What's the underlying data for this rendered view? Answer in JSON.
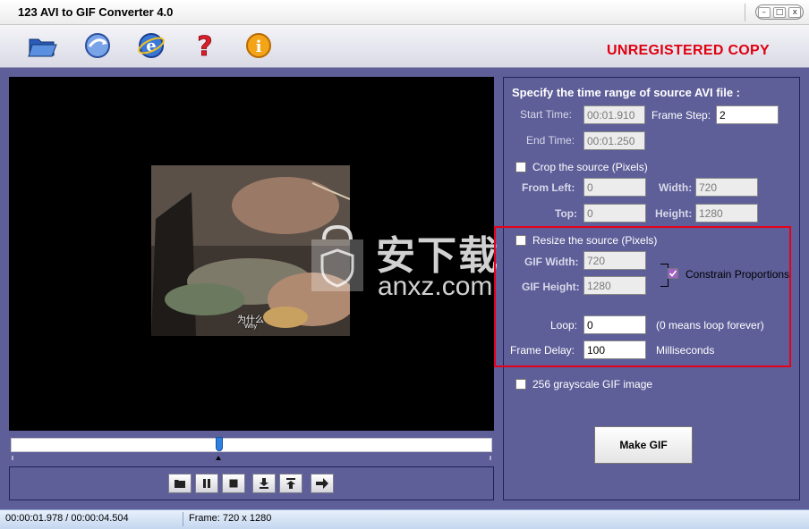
{
  "window": {
    "title": "123 AVI to GIF Converter 4.0"
  },
  "window_controls": {
    "minimize": "–",
    "maximize": "□",
    "close": "x"
  },
  "toolbar": {
    "unregistered": "UNREGISTERED COPY"
  },
  "video": {
    "subtitle_cn": "为什么",
    "subtitle_en": "Why"
  },
  "watermark": {
    "text": "安下载",
    "url": "anxz.com"
  },
  "playback": {
    "position": 0.43
  },
  "settings": {
    "heading": "Specify the time range of source AVI file :",
    "start_time_label": "Start Time:",
    "start_time_value": "00:01.910",
    "frame_step_label": "Frame Step:",
    "frame_step_value": "2",
    "end_time_label": "End Time:",
    "end_time_value": "00:01.250",
    "crop_label": "Crop the source  (Pixels)",
    "crop_checked": false,
    "from_left_label": "From  Left:",
    "from_left_value": "0",
    "crop_width_label": "Width:",
    "crop_width_value": "720",
    "top_label": "Top:",
    "top_value": "0",
    "crop_height_label": "Height:",
    "crop_height_value": "1280",
    "resize_label": "Resize the source  (Pixels)",
    "resize_checked": false,
    "gif_width_label": "GIF Width:",
    "gif_width_value": "720",
    "gif_height_label": "GIF Height:",
    "gif_height_value": "1280",
    "constrain_label": "Constrain Proportions",
    "constrain_checked": true,
    "loop_label": "Loop:",
    "loop_value": "0",
    "loop_hint": "(0 means loop forever)",
    "frame_delay_label": "Frame Delay:",
    "frame_delay_value": "100",
    "frame_delay_unit": "Milliseconds",
    "grayscale_label": "256 grayscale GIF image",
    "grayscale_checked": false,
    "make_gif_label": "Make GIF"
  },
  "status": {
    "time": "00:00:01.978 / 00:00:04.504",
    "frame": "Frame: 720 x 1280"
  },
  "colors": {
    "background": "#5e5e99",
    "unregistered": "#e00010",
    "highlight_box": "#e8001a",
    "slider_thumb": "#2f7fe0"
  }
}
